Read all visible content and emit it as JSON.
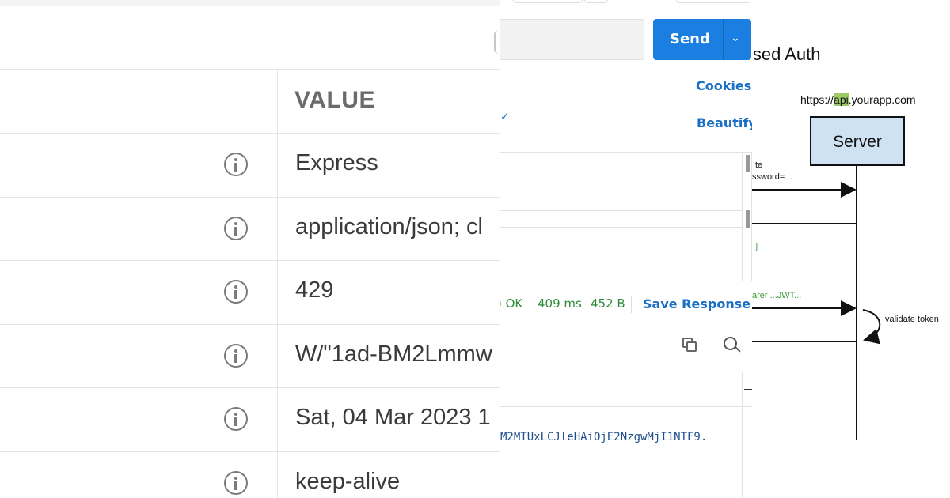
{
  "headers_table": {
    "column_header": "VALUE",
    "rows": [
      {
        "value": "Express"
      },
      {
        "value": "application/json; cl"
      },
      {
        "value": "429"
      },
      {
        "value": "W/\"1ad-BM2Lmmw"
      },
      {
        "value": "Sat, 04 Mar 2023 1"
      },
      {
        "value": "keep-alive"
      }
    ],
    "icon": "info-icon"
  },
  "client": {
    "send_label": "Send",
    "cookies_label": "Cookies",
    "beautify_label": "Beautify",
    "status_code": ") OK",
    "time": "409 ms",
    "size": "452 B",
    "save_response_label": "Save Response",
    "token_text": "M2MTUxLCJleHAiOjE2NzgwMjI1NTF9.",
    "accent": "#1a7fe0"
  },
  "diagram": {
    "title": "ised Auth",
    "url_prefix": "https://",
    "url_highlight": "api",
    "url_suffix": ".yourapp.com",
    "server_label": "Server",
    "msg_login_1": "te",
    "msg_login_2": "ssword=...",
    "msg_brace": "}",
    "msg_bearer": "arer ...JWT...",
    "validate_label": "validate token"
  }
}
